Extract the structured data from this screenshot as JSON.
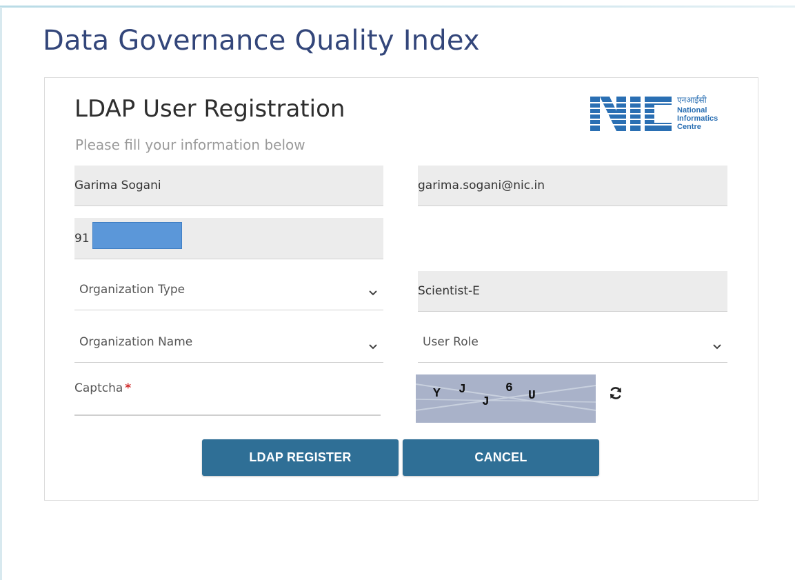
{
  "page": {
    "title": "Data Governance Quality Index"
  },
  "form": {
    "title": "LDAP User Registration",
    "subtitle": "Please fill your information below",
    "logo": {
      "wordmark": "NIC",
      "hindi": "एनआईसी",
      "line1": "National",
      "line2": "Informatics",
      "line3": "Centre"
    },
    "full_name": "Garima Sogani",
    "email": "garima.sogani@nic.in",
    "mobile_prefix": "91",
    "organization_type": {
      "selected": "Organization Type"
    },
    "designation": "Scientist-E",
    "organization_name": {
      "selected": "Organization Name"
    },
    "user_role": {
      "selected": "User Role"
    },
    "captcha": {
      "label": "Captcha",
      "required_marker": "*",
      "chars": [
        "Y",
        "J",
        "J",
        "6",
        "U"
      ]
    },
    "buttons": {
      "register": "LDAP REGISTER",
      "cancel": "CANCEL"
    }
  },
  "colors": {
    "title": "#33467a",
    "button": "#2f6f96",
    "captcha_bg": "#a9b2c9",
    "mask": "#5b97d9",
    "required": "#d12a2a"
  }
}
